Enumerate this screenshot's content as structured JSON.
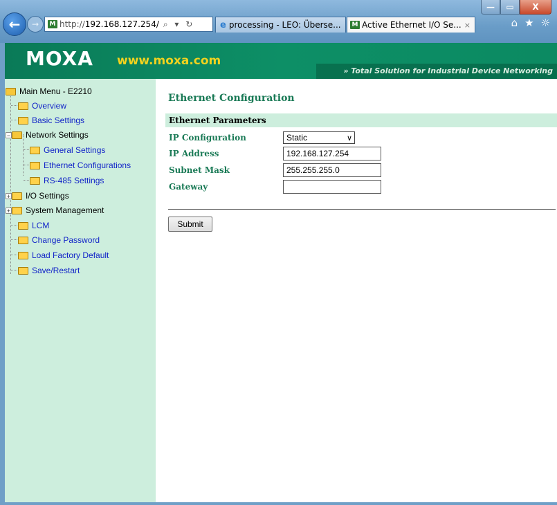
{
  "browser": {
    "window_controls": {
      "minimize": "—",
      "maximize": "▭",
      "close": "X"
    },
    "address_url_prefix": "http://",
    "address_url_host": "192.168.127.254/",
    "address_tools": "⌕ ▾ ↻",
    "tabs": [
      {
        "label": "processing - LEO: Überse...",
        "active": false
      },
      {
        "label": "Active Ethernet I/O Se...",
        "active": true,
        "close": "×"
      }
    ],
    "icons": [
      "home-icon",
      "star-icon",
      "gear-icon"
    ],
    "home_glyph": "⌂",
    "star_glyph": "★",
    "gear_glyph": "☼",
    "back_glyph": "←",
    "forward_glyph": "→",
    "favicon_text": "M"
  },
  "banner": {
    "logo": "MOXA",
    "url": "www.moxa.com",
    "tagline": "» Total Solution for Industrial Device Networking"
  },
  "sidebar": {
    "root": "Main Menu - E2210",
    "items": [
      {
        "label": "Overview"
      },
      {
        "label": "Basic Settings"
      },
      {
        "label": "Network Settings"
      },
      {
        "label": "General Settings"
      },
      {
        "label": "Ethernet Configurations"
      },
      {
        "label": "RS-485 Settings"
      },
      {
        "label": "I/O Settings"
      },
      {
        "label": "System Management"
      },
      {
        "label": "LCM"
      },
      {
        "label": "Change Password"
      },
      {
        "label": "Load Factory Default"
      },
      {
        "label": "Save/Restart"
      }
    ]
  },
  "main": {
    "title": "Ethernet Configuration",
    "section": "Ethernet Parameters",
    "fields": {
      "ip_config_label": "IP Configuration",
      "ip_config_value": "Static",
      "ip_address_label": "IP Address",
      "ip_address_value": "192.168.127.254",
      "subnet_label": "Subnet Mask",
      "subnet_value": "255.255.255.0",
      "gateway_label": "Gateway",
      "gateway_value": ""
    },
    "submit_label": "Submit"
  },
  "colors": {
    "banner_green": "#0d8f66",
    "sidebar_bg": "#cdeedd",
    "label_green": "#1a7a56",
    "link_blue": "#1224c8",
    "logo_url_yellow": "#f2d21e"
  }
}
